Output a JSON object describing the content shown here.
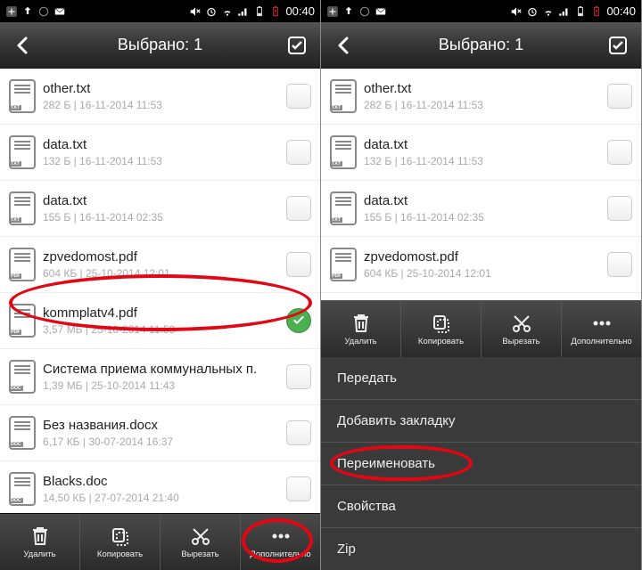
{
  "status": {
    "clock": "00:40"
  },
  "appbar": {
    "title": "Выбрано: 1"
  },
  "filesA": [
    {
      "name": "other.txt",
      "meta": "282 Б | 16-11-2014 11:53",
      "type": "TXT",
      "checked": false
    },
    {
      "name": "data.txt",
      "meta": "132 Б | 16-11-2014 11:53",
      "type": "TXT",
      "checked": false
    },
    {
      "name": "data.txt",
      "meta": "155 Б | 16-11-2014 02:35",
      "type": "TXT",
      "checked": false
    },
    {
      "name": "zpvedomost.pdf",
      "meta": "604 КБ | 25-10-2014 12:01",
      "type": "PDF",
      "checked": false
    },
    {
      "name": "kommplatv4.pdf",
      "meta": "3,57 МБ | 25-10-2014 11:58",
      "type": "PDF",
      "checked": true
    },
    {
      "name": "Система приема коммунальных п.",
      "meta": "1,39 МБ | 25-10-2014 11:43",
      "type": "DOC",
      "checked": false
    },
    {
      "name": "Без названия.docx",
      "meta": "6,17 КБ | 30-07-2014 16:37",
      "type": "DOC",
      "checked": false
    },
    {
      "name": "Blacks.doc",
      "meta": "14,50 КБ | 27-07-2014 21:40",
      "type": "DOC",
      "checked": false
    }
  ],
  "filesB": [
    {
      "name": "other.txt",
      "meta": "282 Б | 16-11-2014 11:53",
      "type": "TXT",
      "checked": false
    },
    {
      "name": "data.txt",
      "meta": "132 Б | 16-11-2014 11:53",
      "type": "TXT",
      "checked": false
    },
    {
      "name": "data.txt",
      "meta": "155 Б | 16-11-2014 02:35",
      "type": "TXT",
      "checked": false
    },
    {
      "name": "zpvedomost.pdf",
      "meta": "604 КБ | 25-10-2014 12:01",
      "type": "PDF",
      "checked": false
    }
  ],
  "toolbar": {
    "delete": "Удалить",
    "copy": "Копировать",
    "cut": "Вырезать",
    "more": "Дополнительно"
  },
  "popup": {
    "items": [
      "Передать",
      "Добавить закладку",
      "Переименовать",
      "Свойства",
      "Zip"
    ]
  }
}
